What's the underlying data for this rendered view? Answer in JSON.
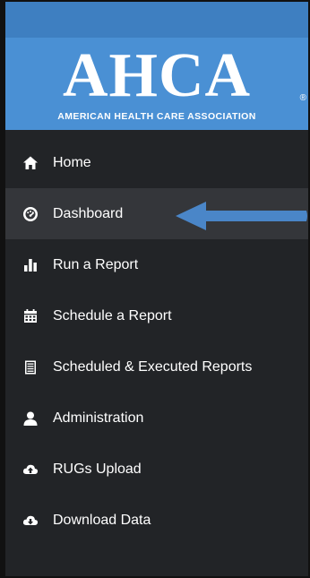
{
  "brand": {
    "logo_text": "AHCA",
    "registered_mark": "®",
    "tagline": "AMERICAN HEALTH CARE ASSOCIATION"
  },
  "nav": {
    "items": [
      {
        "label": "Home",
        "icon": "home-icon",
        "active": false
      },
      {
        "label": "Dashboard",
        "icon": "dashboard-icon",
        "active": true
      },
      {
        "label": "Run a Report",
        "icon": "bar-chart-icon",
        "active": false
      },
      {
        "label": "Schedule a Report",
        "icon": "calendar-icon",
        "active": false
      },
      {
        "label": "Scheduled & Executed Reports",
        "icon": "document-list-icon",
        "active": false
      },
      {
        "label": "Administration",
        "icon": "user-icon",
        "active": false
      },
      {
        "label": "RUGs Upload",
        "icon": "cloud-upload-icon",
        "active": false
      },
      {
        "label": "Download Data",
        "icon": "cloud-download-icon",
        "active": false
      }
    ]
  },
  "annotation": {
    "pointer": "arrow-pointing-left",
    "target": "Dashboard"
  },
  "colors": {
    "topbar": "#3e7fc1",
    "brand_bg": "#4a90d4",
    "sidebar_bg": "#222427",
    "active_bg": "#34363a",
    "arrow": "#4a86c8",
    "text": "#ffffff"
  }
}
